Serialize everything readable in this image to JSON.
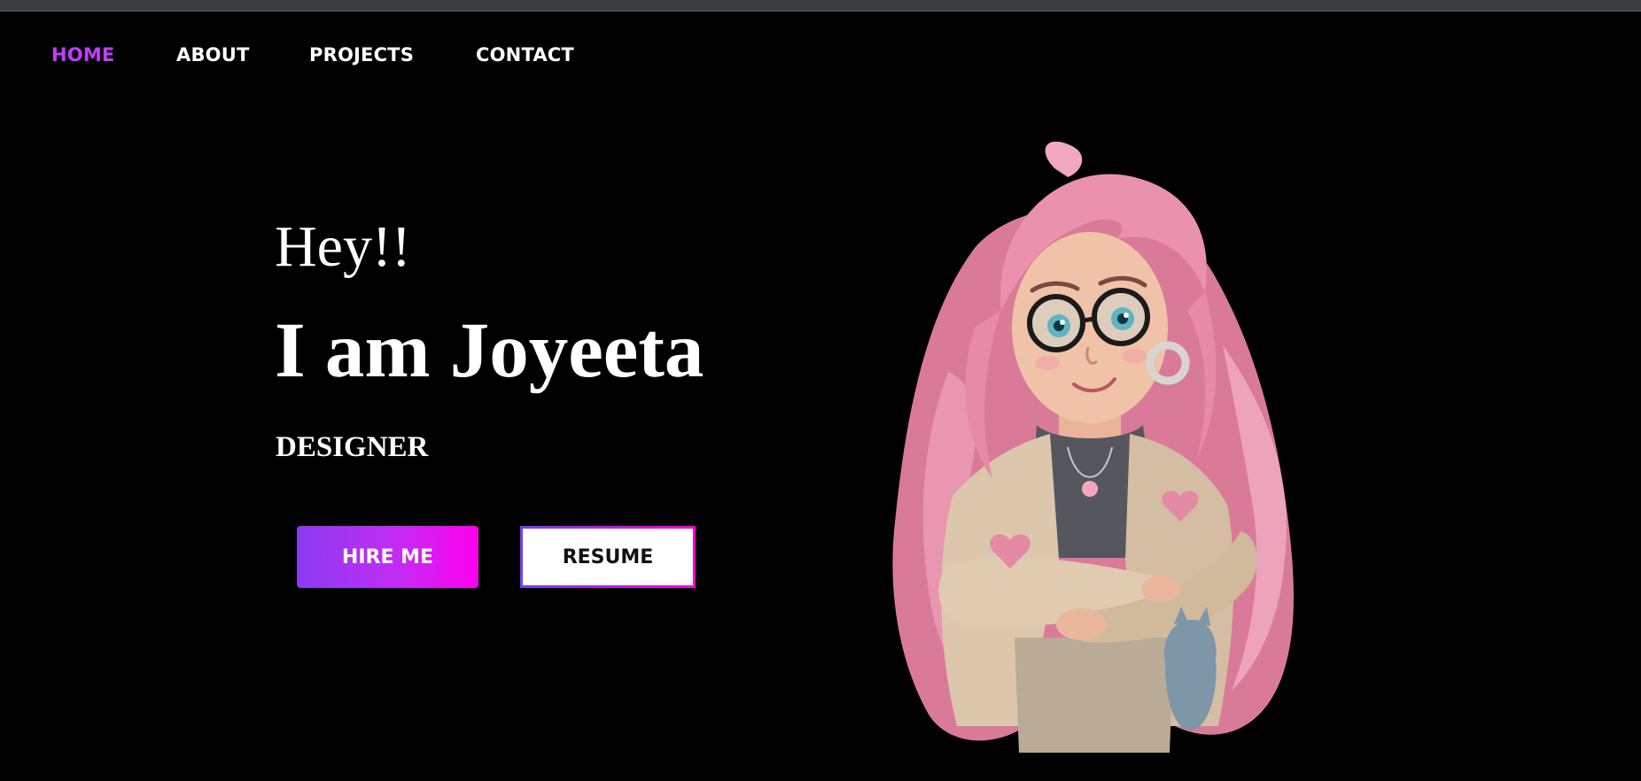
{
  "nav": {
    "items": [
      {
        "label": "HOME",
        "active": true
      },
      {
        "label": "ABOUT",
        "active": false
      },
      {
        "label": "PROJECTS",
        "active": false
      },
      {
        "label": "CONTACT",
        "active": false
      }
    ],
    "active_color": "#c13dff"
  },
  "hero": {
    "greeting": "Hey!!",
    "name": "I am Joyeeta",
    "role": "DESIGNER",
    "hire_label": "HIRE ME",
    "resume_label": "RESUME"
  },
  "portrait": {
    "icon": "cartoon-girl-portrait",
    "hair_color": "#e88aa6"
  },
  "colors": {
    "background": "#000000",
    "accent_start": "#8a3cf0",
    "accent_end": "#ff00ee"
  }
}
